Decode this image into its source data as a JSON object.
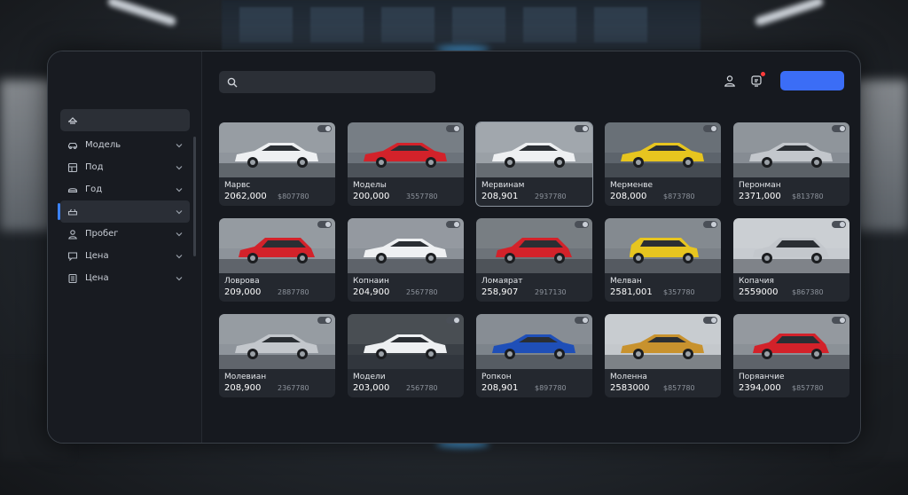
{
  "header": {
    "search_placeholder": "",
    "icons": [
      "search-icon",
      "user-icon",
      "notification-icon"
    ],
    "accent_color": "#3b6df6",
    "notification_dot_color": "#ff3b3b"
  },
  "sidebar": {
    "search_icon": "filter-icon",
    "items": [
      {
        "label": "Модель",
        "icon": "car-icon",
        "active": false
      },
      {
        "label": "Под",
        "icon": "grid-icon",
        "active": false
      },
      {
        "label": "Год",
        "icon": "calendar-icon",
        "active": false
      },
      {
        "label": "",
        "icon": "car-body-icon",
        "active": true
      },
      {
        "label": "Пробег",
        "icon": "person-icon",
        "active": false
      },
      {
        "label": "Цена",
        "icon": "chat-icon",
        "active": false
      },
      {
        "label": "Цена",
        "icon": "list-icon",
        "active": false
      }
    ]
  },
  "cards": [
    {
      "name": "Марвс",
      "price": "2062,000",
      "old": "$807780",
      "car": "white",
      "bg": "#8f959c",
      "type": "sedan"
    },
    {
      "name": "Моделы",
      "price": "200,000",
      "old": "3557780",
      "car": "red",
      "bg": "#6c737b",
      "type": "sedan"
    },
    {
      "name": "Мервинам",
      "price": "208,901",
      "old": "2937780",
      "car": "white",
      "bg": "#9aa0a6",
      "type": "sedan",
      "selected": true
    },
    {
      "name": "Мерменве",
      "price": "208,000",
      "old": "$873780",
      "car": "yellow",
      "bg": "#5d646c",
      "type": "sedan"
    },
    {
      "name": "Перонман",
      "price": "2371,000",
      "old": "$813780",
      "car": "silver",
      "bg": "#868c93",
      "type": "sedan"
    },
    {
      "name": "Ловрова",
      "price": "209,000",
      "old": "2887780",
      "car": "red",
      "bg": "#8d939a",
      "type": "hatch"
    },
    {
      "name": "Копнаин",
      "price": "204,900",
      "old": "2567780",
      "car": "white",
      "bg": "#8b9198",
      "type": "sedan"
    },
    {
      "name": "Ломаярат",
      "price": "258,907",
      "old": "2917130",
      "car": "red",
      "bg": "#6d7379",
      "type": "wagon"
    },
    {
      "name": "Мелван",
      "price": "2581,001",
      "old": "$357780",
      "car": "yellow",
      "bg": "#7a8087",
      "type": "suv"
    },
    {
      "name": "Копачия",
      "price": "2559000",
      "old": "$867380",
      "car": "silver",
      "bg": "#c7cbd0",
      "type": "hatch"
    },
    {
      "name": "Молевиан",
      "price": "208,900",
      "old": "2367780",
      "car": "silver",
      "bg": "#8e949b",
      "type": "sedan"
    },
    {
      "name": "Модели",
      "price": "203,000",
      "old": "2567780",
      "car": "white",
      "bg": "#3a3f45",
      "type": "sedan"
    },
    {
      "name": "Ропкон",
      "price": "208,901",
      "old": "$897780",
      "car": "blue",
      "bg": "#7d848b",
      "type": "sedan"
    },
    {
      "name": "Моленна",
      "price": "2583000",
      "old": "$857780",
      "car": "gold",
      "bg": "#c4c8cc",
      "type": "sedan"
    },
    {
      "name": "Поряанчие",
      "price": "2394,000",
      "old": "$857780",
      "car": "red",
      "bg": "#8b9197",
      "type": "hatch"
    }
  ],
  "car_colors": {
    "white": "#eef0f2",
    "red": "#d3222a",
    "yellow": "#e7c51f",
    "silver": "#c3c7cc",
    "blue": "#1f4fb8",
    "gold": "#c8922e"
  }
}
